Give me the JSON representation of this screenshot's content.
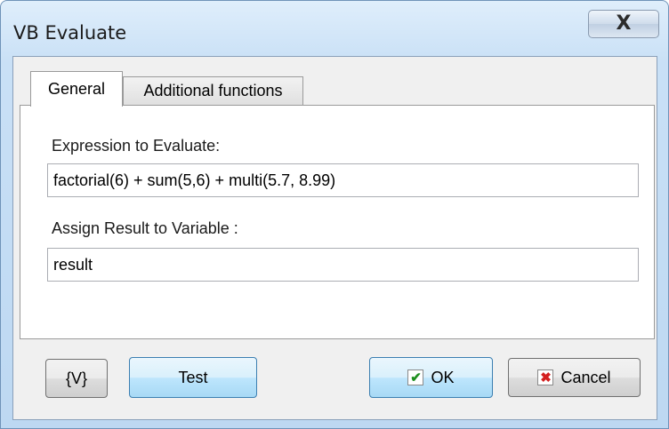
{
  "window": {
    "title": "VB Evaluate",
    "close_glyph": "X"
  },
  "tabs": [
    {
      "label": "General",
      "selected": true
    },
    {
      "label": "Additional functions",
      "selected": false
    }
  ],
  "general": {
    "expression_label": "Expression to Evaluate:",
    "expression_value": "factorial(6) + sum(5,6) + multi(5.7, 8.99)",
    "result_label": "Assign Result to Variable :",
    "result_value": "result"
  },
  "buttons": {
    "variables_label": "{V}",
    "test_label": "Test",
    "ok_label": "OK",
    "cancel_label": "Cancel"
  },
  "icons": {
    "ok": "check-icon",
    "cancel": "cancel-x-icon",
    "close": "close-icon"
  },
  "colors": {
    "ok_check": "#1f8f1f",
    "cancel_x": "#d42020",
    "title_bar": "#c9e0f6"
  }
}
